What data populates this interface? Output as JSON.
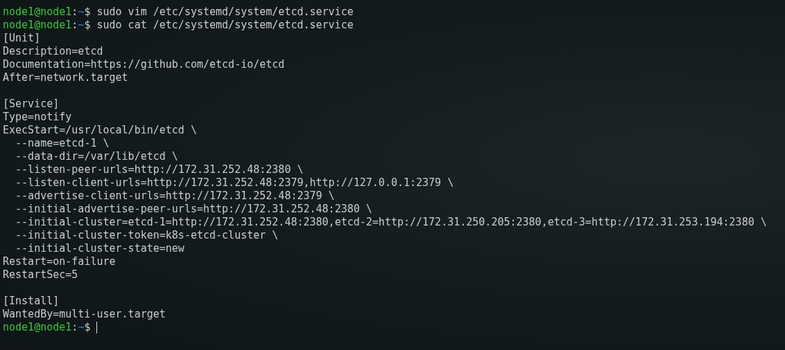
{
  "terminal": {
    "lines": [
      {
        "kind": "prompt",
        "user_host": "node1@node1",
        "separator": ":",
        "path": "~",
        "symbol": "$",
        "command": "sudo vim /etc/systemd/system/etcd.service"
      },
      {
        "kind": "prompt",
        "user_host": "node1@node1",
        "separator": ":",
        "path": "~",
        "symbol": "$",
        "command": "sudo cat /etc/systemd/system/etcd.service"
      },
      {
        "kind": "output",
        "text": "[Unit]"
      },
      {
        "kind": "output",
        "text": "Description=etcd"
      },
      {
        "kind": "output",
        "text": "Documentation=https://github.com/etcd-io/etcd"
      },
      {
        "kind": "output",
        "text": "After=network.target"
      },
      {
        "kind": "blank"
      },
      {
        "kind": "output",
        "text": "[Service]"
      },
      {
        "kind": "output",
        "text": "Type=notify"
      },
      {
        "kind": "output",
        "text": "ExecStart=/usr/local/bin/etcd \\"
      },
      {
        "kind": "output",
        "text": "  --name=etcd-1 \\"
      },
      {
        "kind": "output",
        "text": "  --data-dir=/var/lib/etcd \\"
      },
      {
        "kind": "output",
        "text": "  --listen-peer-urls=http://172.31.252.48:2380 \\"
      },
      {
        "kind": "output",
        "text": "  --listen-client-urls=http://172.31.252.48:2379,http://127.0.0.1:2379 \\"
      },
      {
        "kind": "output",
        "text": "  --advertise-client-urls=http://172.31.252.48:2379 \\"
      },
      {
        "kind": "output",
        "text": "  --initial-advertise-peer-urls=http://172.31.252.48:2380 \\"
      },
      {
        "kind": "output",
        "text": "  --initial-cluster=etcd-1=http://172.31.252.48:2380,etcd-2=http://172.31.250.205:2380,etcd-3=http://172.31.253.194:2380 \\"
      },
      {
        "kind": "output",
        "text": "  --initial-cluster-token=k8s-etcd-cluster \\"
      },
      {
        "kind": "output",
        "text": "  --initial-cluster-state=new"
      },
      {
        "kind": "output",
        "text": "Restart=on-failure"
      },
      {
        "kind": "output",
        "text": "RestartSec=5"
      },
      {
        "kind": "blank"
      },
      {
        "kind": "output",
        "text": "[Install]"
      },
      {
        "kind": "output",
        "text": "WantedBy=multi-user.target"
      },
      {
        "kind": "prompt",
        "user_host": "node1@node1",
        "separator": ":",
        "path": "~",
        "symbol": "$",
        "cursor": true
      }
    ]
  }
}
